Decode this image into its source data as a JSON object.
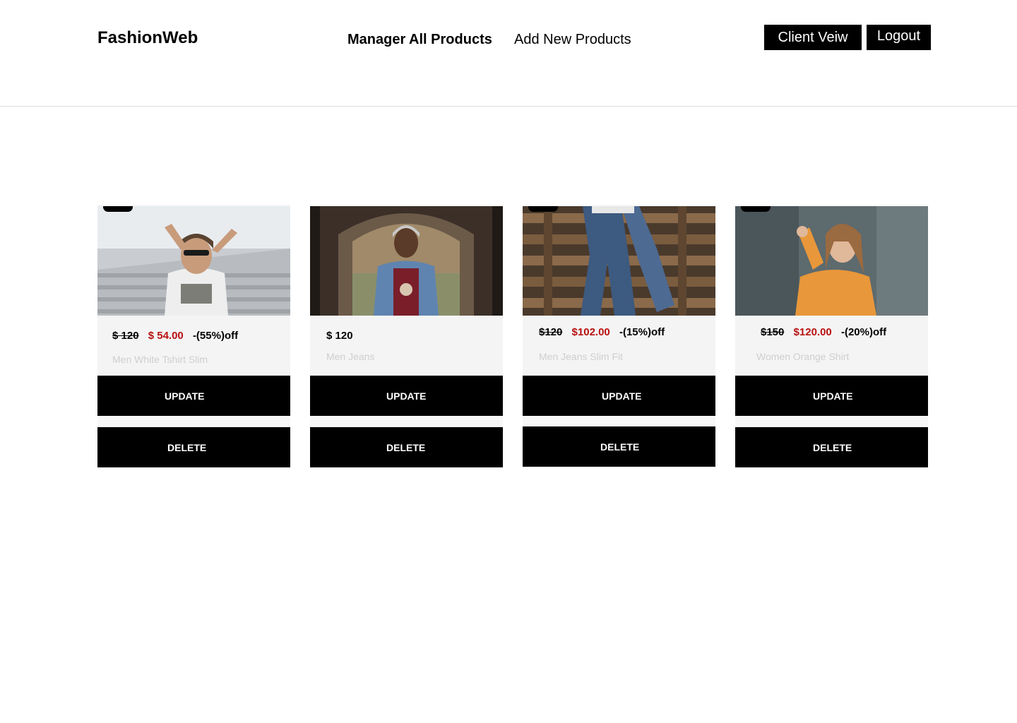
{
  "header": {
    "logo": "FashionWeb",
    "nav": {
      "manage": "Manager All Products",
      "add": "Add New Products"
    },
    "buttons": {
      "client": "Client Veiw",
      "logout": "Logout"
    }
  },
  "products": [
    {
      "old_price": "$ 120",
      "new_price": "$ 54.00",
      "discount": "-(55%)off",
      "name": "Men White Tshirt Slim",
      "update": "UPDATE",
      "delete": "DELETE",
      "image": "man-white-tshirt-sunglasses"
    },
    {
      "old_price": "",
      "new_price": "",
      "price": "$ 120",
      "discount": "",
      "name": "Men Jeans",
      "update": "UPDATE",
      "delete": "DELETE",
      "image": "man-denim-jacket-hoodie"
    },
    {
      "old_price": "$120",
      "new_price": "$102.00",
      "discount": "-(15%)off",
      "name": "Men Jeans Slim Fit",
      "update": "UPDATE",
      "delete": "DELETE",
      "image": "jeans-legs-pallets"
    },
    {
      "old_price": "$150",
      "new_price": "$120.00",
      "discount": "-(20%)off",
      "name": "Women Orange Shirt",
      "update": "UPDATE",
      "delete": "DELETE",
      "image": "woman-orange-shirt"
    }
  ]
}
